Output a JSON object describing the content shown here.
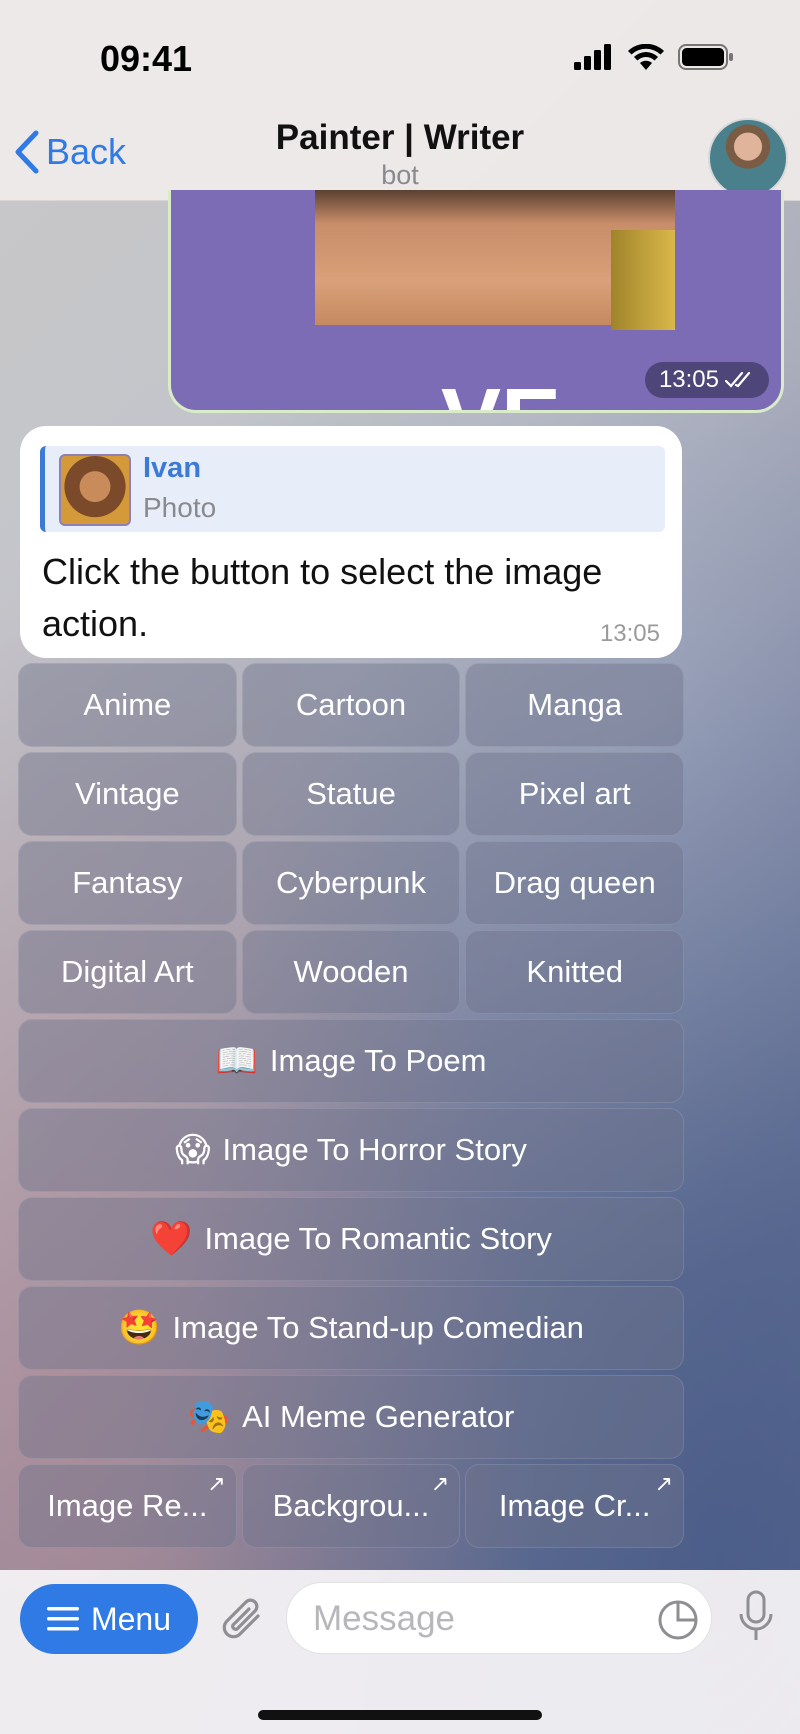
{
  "status_bar": {
    "time": "09:41"
  },
  "header": {
    "back_label": "Back",
    "title": "Painter | Writer",
    "subtitle": "bot"
  },
  "image_message": {
    "time": "13:05",
    "overlay_text": "VE"
  },
  "text_message": {
    "reply_name": "Ivan",
    "reply_type": "Photo",
    "text": "Click the button to select the image action.",
    "time": "13:05"
  },
  "keyboard": {
    "rows": [
      [
        "Anime",
        "Cartoon",
        "Manga"
      ],
      [
        "Vintage",
        "Statue",
        "Pixel art"
      ],
      [
        "Fantasy",
        "Cyberpunk",
        "Drag queen"
      ],
      [
        "Digital Art",
        "Wooden",
        "Knitted"
      ]
    ],
    "wide_buttons": [
      {
        "emoji": "📖",
        "label": "Image To Poem"
      },
      {
        "emoji": "😱",
        "label": "Image To Horror Story"
      },
      {
        "emoji": "❤️",
        "label": "Image To Romantic Story"
      },
      {
        "emoji": "🤩",
        "label": "Image To Stand-up Comedian"
      },
      {
        "emoji": "🎭",
        "label": "AI Meme Generator"
      }
    ],
    "link_buttons": [
      "Image Re...",
      "Backgrou...",
      "Image Cr..."
    ]
  },
  "bottom_bar": {
    "menu_label": "Menu",
    "input_placeholder": "Message"
  },
  "colors": {
    "accent": "#2f7ae5",
    "reply_name": "#3d7ad6"
  }
}
